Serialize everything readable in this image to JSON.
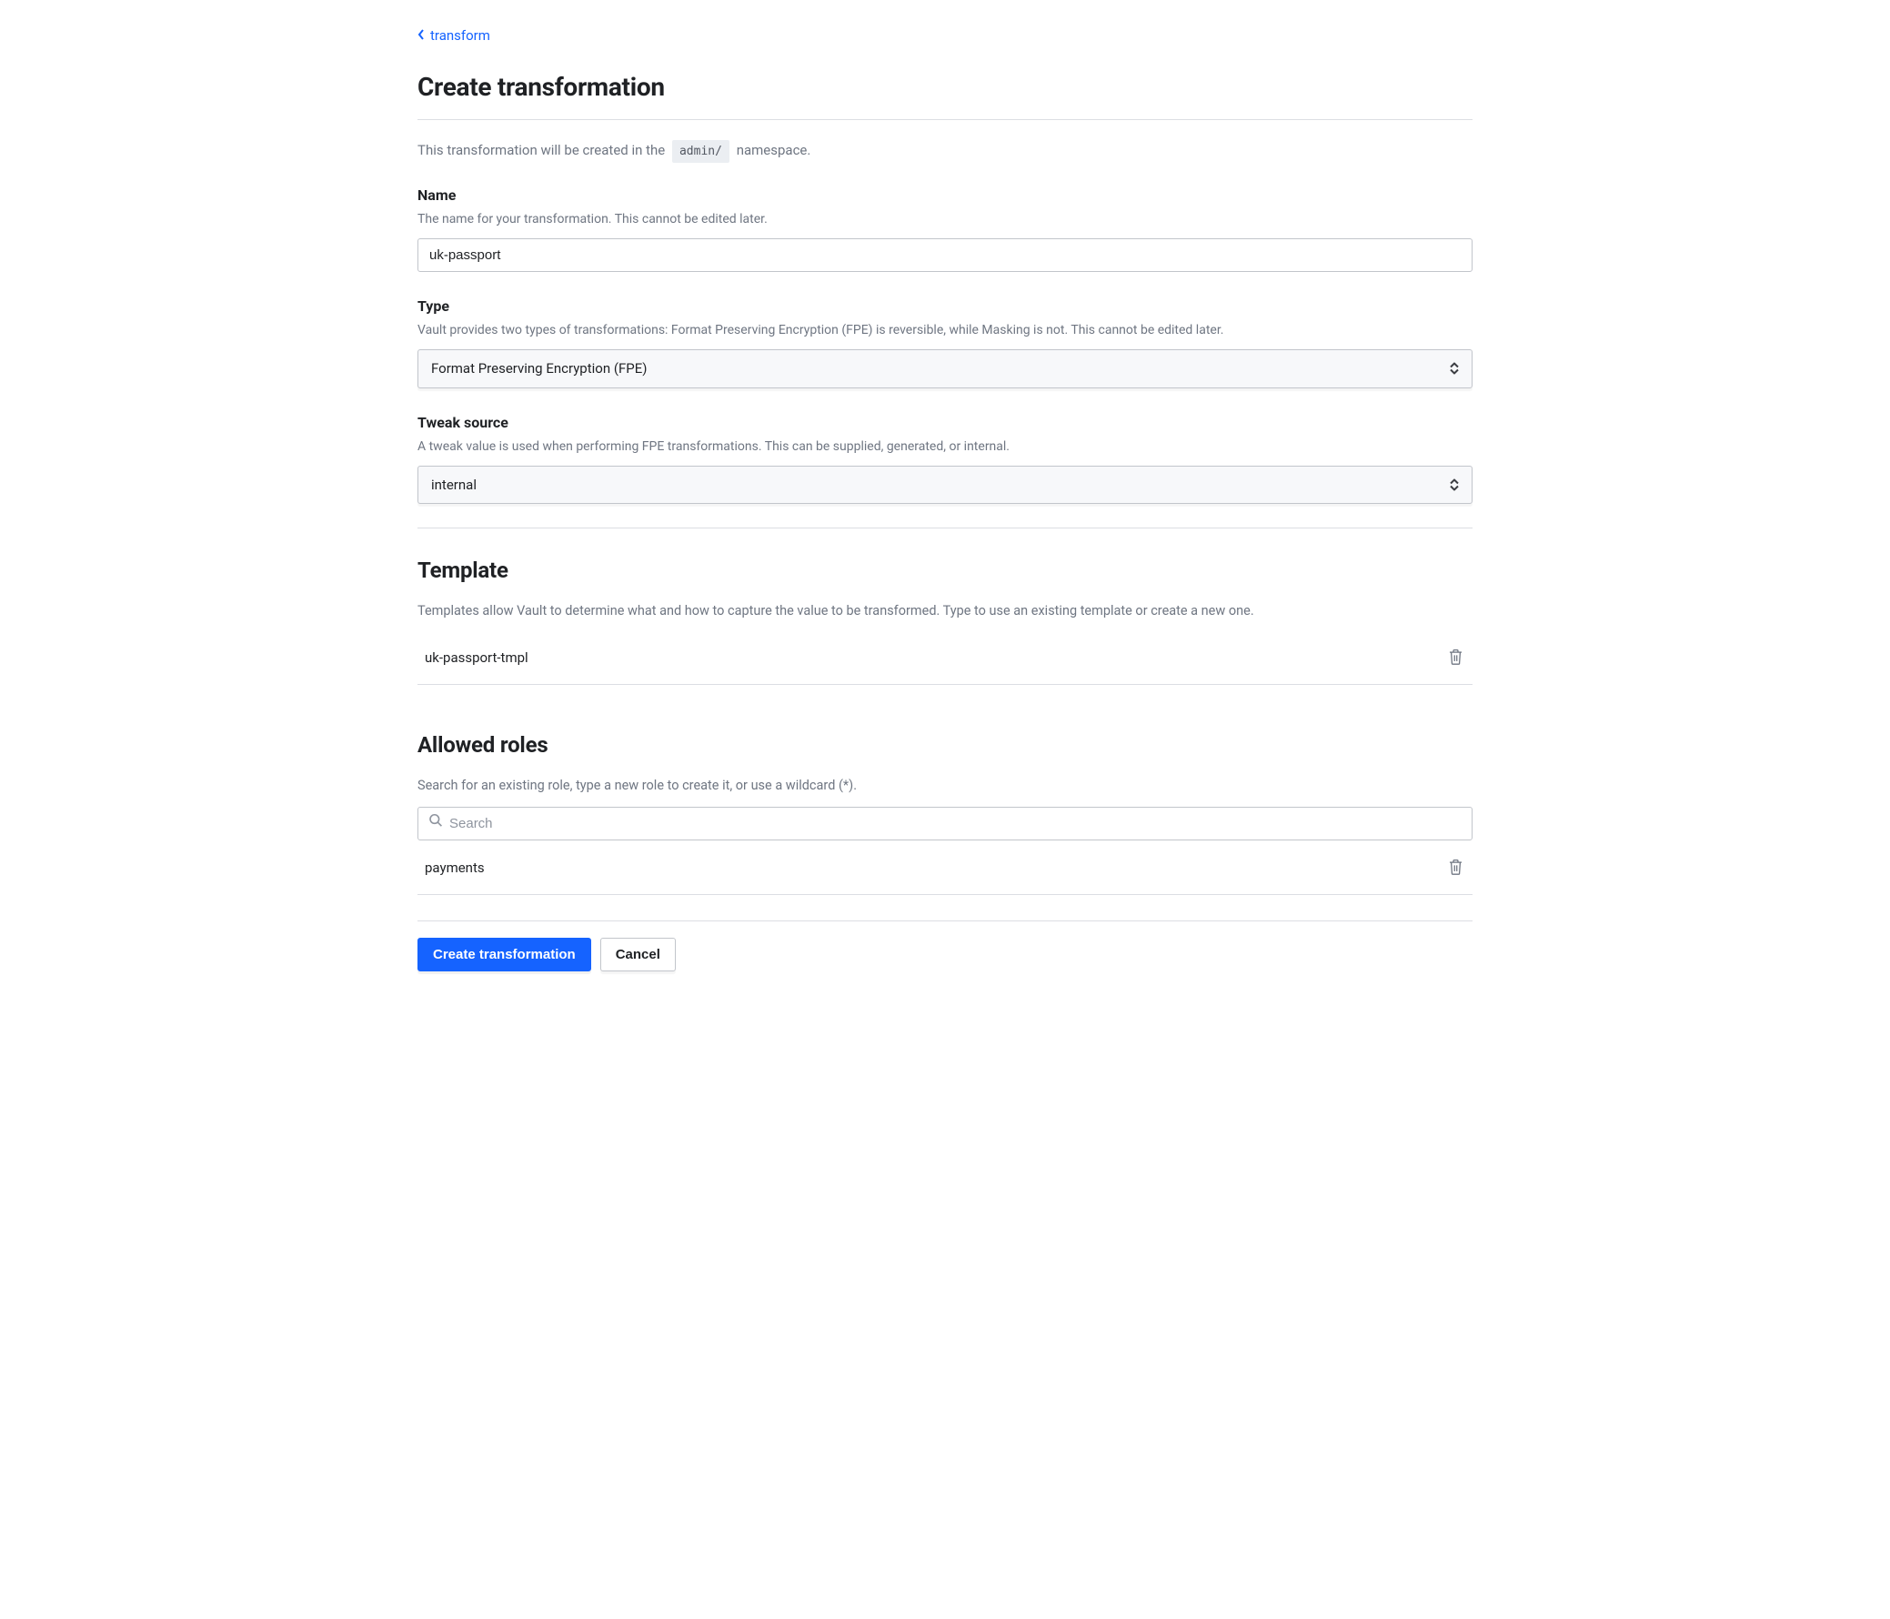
{
  "breadcrumb": {
    "back_label": "transform"
  },
  "page": {
    "title": "Create transformation",
    "intro_prefix": "This transformation will be created in the",
    "namespace_chip": "admin/",
    "intro_suffix": "namespace."
  },
  "fields": {
    "name": {
      "label": "Name",
      "help": "The name for your transformation. This cannot be edited later.",
      "value": "uk-passport"
    },
    "type": {
      "label": "Type",
      "help": "Vault provides two types of transformations: Format Preserving Encryption (FPE) is reversible, while Masking is not. This cannot be edited later.",
      "value": "Format Preserving Encryption (FPE)"
    },
    "tweak_source": {
      "label": "Tweak source",
      "help": "A tweak value is used when performing FPE transformations. This can be supplied, generated, or internal.",
      "value": "internal"
    }
  },
  "template": {
    "title": "Template",
    "help": "Templates allow Vault to determine what and how to capture the value to be transformed. Type to use an existing template or create a new one.",
    "items": [
      "uk-passport-tmpl"
    ]
  },
  "allowed_roles": {
    "title": "Allowed roles",
    "help": "Search for an existing role, type a new role to create it, or use a wildcard (*).",
    "search_placeholder": "Search",
    "items": [
      "payments"
    ]
  },
  "actions": {
    "submit": "Create transformation",
    "cancel": "Cancel"
  }
}
